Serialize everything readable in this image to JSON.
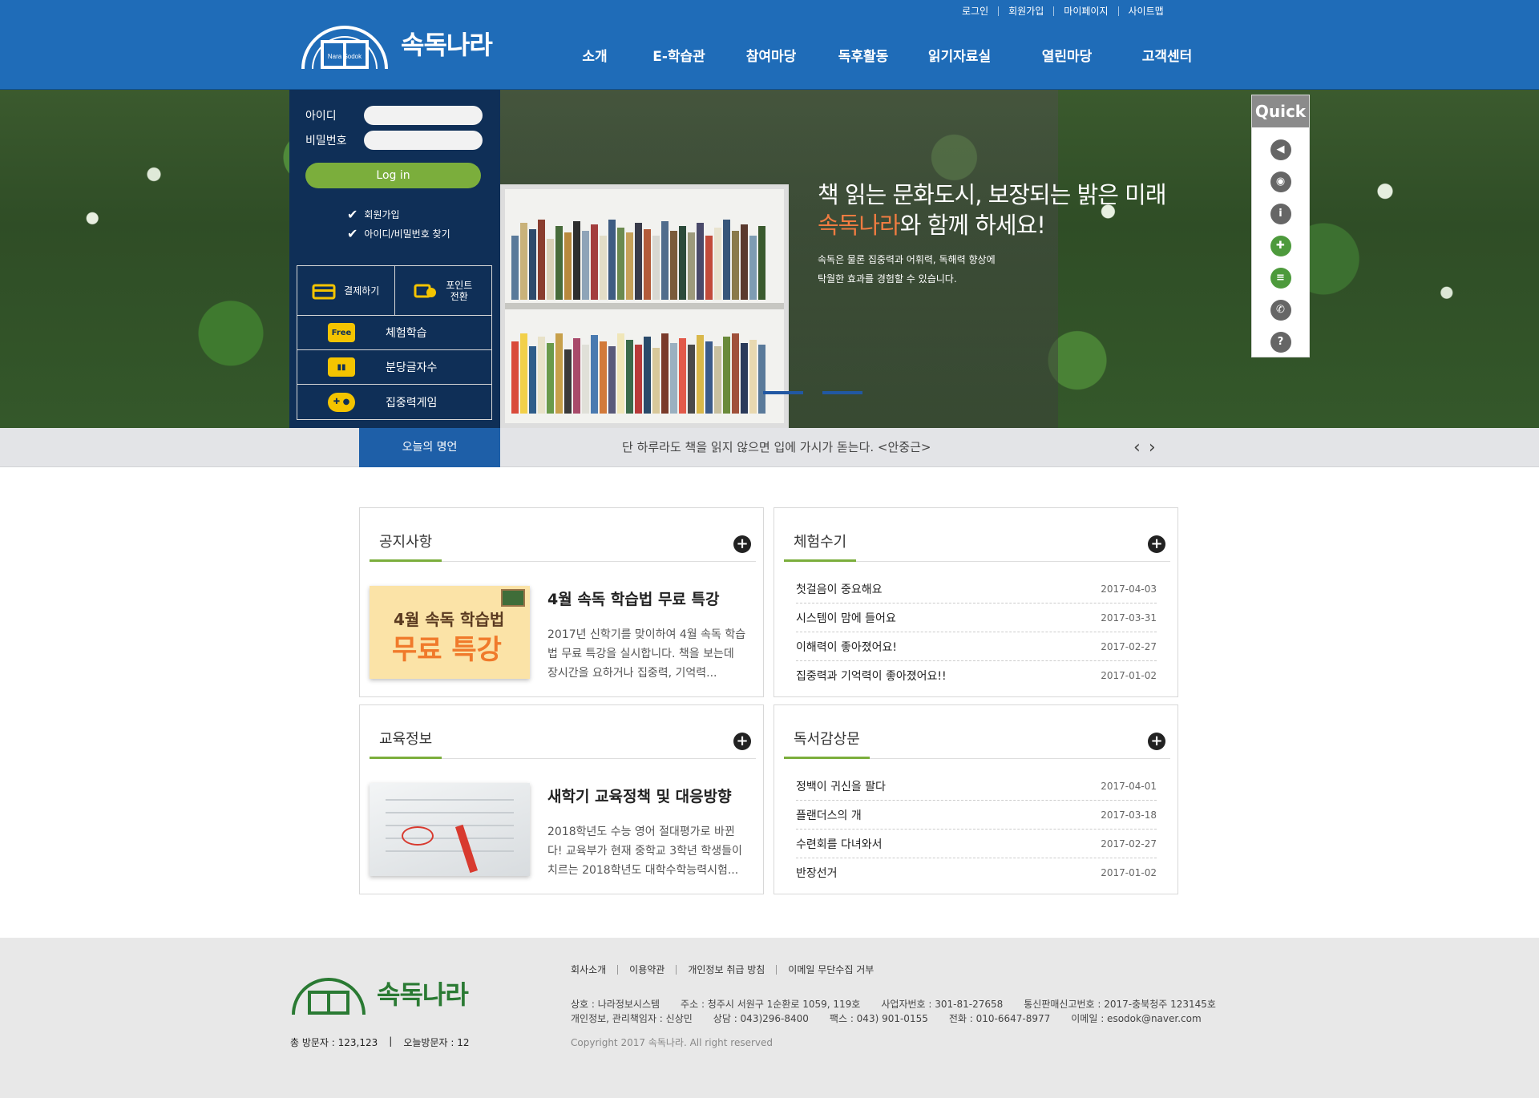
{
  "brand": {
    "name": "속독나라",
    "badge": "Nara Sodok"
  },
  "top_links": [
    "로그인",
    "회원가입",
    "마이페이지",
    "사이트맵"
  ],
  "gnb": [
    "소개",
    "E-학습관",
    "참여마당",
    "독후활동",
    "읽기자료실",
    "열린마당",
    "고객센터"
  ],
  "login": {
    "id_label": "아이디",
    "pw_label": "비밀번호",
    "button": "Log in",
    "join": "회원가입",
    "find": "아이디/비밀번호 찾기"
  },
  "services": {
    "pay": "결제하기",
    "point": "포인트\n전환",
    "trial": "체험학습",
    "speed": "분당글자수",
    "game": "집중력게임",
    "free_icon": "Free"
  },
  "hero": {
    "line1": "책 읽는 문화도시, 보장되는 밝은 미래",
    "accent": "속독나라",
    "line2_rest": "와 함께 하세요!",
    "sub1": "속독은 물론 집중력과 어휘력, 독해력 향상에",
    "sub2": "탁월한 효과를 경험할 수 있습니다."
  },
  "quick": {
    "title": "Quick"
  },
  "quote": {
    "label": "오늘의 명언",
    "text": "단 하루라도 책을 읽지 않으면 입에 가시가 돋는다. <안중근>",
    "prev": "‹",
    "next": "›"
  },
  "notice": {
    "title": "공지사항",
    "feature_title": "4월 속독 학습법 무료 특강",
    "feature_desc": "2017년 신학기를 맞이하여 4월 속독 학습법 무료 특강을 실시합니다. 책을 보는데 장시간을 요하거나 집중력, 기억력...",
    "thumb_line1": "4월 속독 학습법",
    "thumb_line2": "무료 특강"
  },
  "experience": {
    "title": "체험수기",
    "items": [
      {
        "title": "첫걸음이 중요해요",
        "date": "2017-04-03"
      },
      {
        "title": "시스템이 맘에 들어요",
        "date": "2017-03-31"
      },
      {
        "title": "이해력이 좋아졌어요!",
        "date": "2017-02-27"
      },
      {
        "title": "집중력과 기억력이 좋아졌어요!!",
        "date": "2017-01-02"
      }
    ]
  },
  "education": {
    "title": "교육정보",
    "feature_title": "새학기 교육정책 및 대응방향",
    "feature_desc": "2018학년도 수능 영어 절대평가로 바뀐다! 교육부가 현재 중학교 3학년 학생들이 치르는 2018학년도 대학수학능력시험..."
  },
  "review": {
    "title": "독서감상문",
    "items": [
      {
        "title": "정백이 귀신을 팔다",
        "date": "2017-04-01"
      },
      {
        "title": "플랜더스의 개",
        "date": "2017-03-18"
      },
      {
        "title": "수련회를 다녀와서",
        "date": "2017-02-27"
      },
      {
        "title": "반장선거",
        "date": "2017-01-02"
      }
    ]
  },
  "footer": {
    "links": [
      "회사소개",
      "이용약관",
      "개인정보 취급 방침",
      "이메일 무단수집 거부"
    ],
    "info_row1": [
      "상호 : 나라정보시스템",
      "주소 : 청주시 서원구 1순환로 1059, 119호",
      "사업자번호 : 301-81-27658",
      "통신판매신고번호 : 2017-충북청주 123145호"
    ],
    "info_row2": [
      "개인정보, 관리책임자 : 신상민",
      "상담 : 043)296-8400",
      "팩스 : 043) 901-0155",
      "전화 : 010-6647-8977",
      "이메일 : esodok@naver.com"
    ],
    "copyright": "Copyright 2017 속독나라. All right reserved",
    "visit_total": "총 방문자 : 123,123",
    "visit_sep": "|",
    "visit_today": "오늘방문자 : 12"
  },
  "colors": {
    "primary": "#1f6cb8",
    "accent": "#f07c41",
    "green": "#7bae3c",
    "navy": "#0f2f57"
  },
  "icons": [
    "check-icon",
    "card-icon",
    "coin-icon",
    "free-book-icon",
    "book-icon",
    "gamepad-icon",
    "speaker-icon",
    "audio-icon",
    "info-icon",
    "game-icon",
    "notes-icon",
    "phone-icon",
    "help-icon",
    "plus-circle-icon"
  ]
}
